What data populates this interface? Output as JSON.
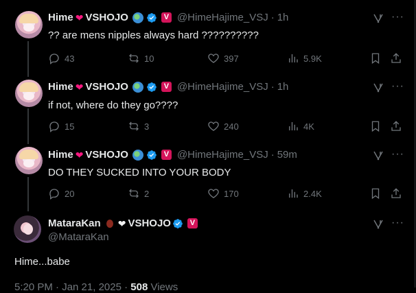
{
  "tweets": [
    {
      "author": {
        "name": "Hime",
        "brand": "VSHOJO",
        "handle": "@HimeHajime_VSJ",
        "time": "1h"
      },
      "text": "?? are mens nipples always hard ??????????",
      "stats": {
        "replies": "43",
        "reposts": "10",
        "likes": "397",
        "views": "5.9K"
      }
    },
    {
      "author": {
        "name": "Hime",
        "brand": "VSHOJO",
        "handle": "@HimeHajime_VSJ",
        "time": "1h"
      },
      "text": "if not, where do they go????",
      "stats": {
        "replies": "15",
        "reposts": "3",
        "likes": "240",
        "views": "4K"
      }
    },
    {
      "author": {
        "name": "Hime",
        "brand": "VSHOJO",
        "handle": "@HimeHajime_VSJ",
        "time": "59m"
      },
      "text": "DO THEY SUCKED INTO YOUR BODY",
      "stats": {
        "replies": "20",
        "reposts": "2",
        "likes": "170",
        "views": "2.4K"
      }
    }
  ],
  "focus": {
    "author": {
      "name": "MataraKan",
      "brand": "VSHOJO",
      "handle": "@MataraKan"
    },
    "text": "Hime...babe",
    "meta": {
      "time": "5:20 PM · Jan 21, 2025 ·",
      "views": "508",
      "views_label": "Views"
    }
  },
  "icons": {
    "reply": "reply-icon",
    "repost": "repost-icon",
    "like": "like-icon",
    "views": "views-icon",
    "bookmark": "bookmark-icon",
    "share": "share-icon",
    "grok": "grok-icon",
    "more": "more-icon",
    "verified": "verified-badge-icon",
    "affiliate": "vshojo-affiliate-icon",
    "globe": "globe-emoji-icon"
  },
  "colors": {
    "background": "#000000",
    "text": "#e7e9ea",
    "muted": "#71767b",
    "verified": "#1d9bf0",
    "heart": "#f91880",
    "affiliate": "#d4145a"
  }
}
